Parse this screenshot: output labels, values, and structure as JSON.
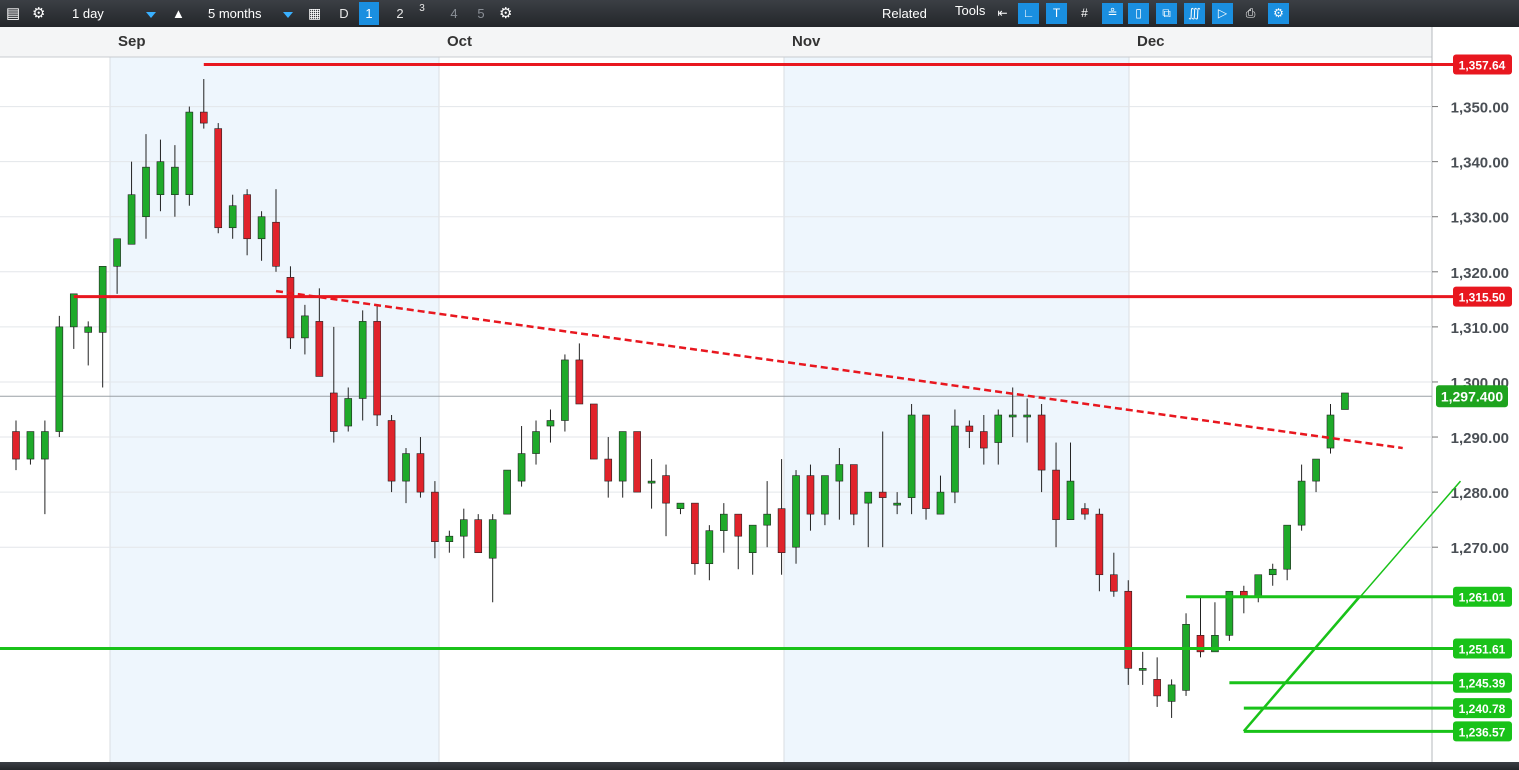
{
  "toolbar": {
    "interval": "1 day",
    "range": "5 months",
    "period_label": "D",
    "layout_numbers": [
      "1",
      "2",
      "3",
      "4",
      "5"
    ],
    "active_layout": "1",
    "related_label": "Related",
    "tools_label": "Tools"
  },
  "colors": {
    "up": "#1faa2a",
    "down": "#e0232b",
    "resistance": "#e8171f",
    "support": "#19c219",
    "last_price_tag": "#1ea31e",
    "shaded_month": "#eef6fd"
  },
  "chart_data": {
    "type": "candlestick",
    "x_labels": [
      "Sep",
      "Oct",
      "Nov",
      "Dec"
    ],
    "y_ticks": [
      "1,350.00",
      "1,340.00",
      "1,330.00",
      "1,320.00",
      "1,310.00",
      "1,300.00",
      "1,290.00",
      "1,280.00",
      "1,270.00"
    ],
    "ylim": [
      1231,
      1359
    ],
    "last_price": "1,297.400",
    "last_price_value": 1297.4,
    "horizontal_levels": [
      {
        "label": "1,357.64",
        "value": 1357.64,
        "kind": "resistance"
      },
      {
        "label": "1,315.50",
        "value": 1315.5,
        "kind": "resistance"
      },
      {
        "label": "1,261.01",
        "value": 1261.01,
        "kind": "support"
      },
      {
        "label": "1,251.61",
        "value": 1251.61,
        "kind": "support"
      },
      {
        "label": "1,245.39",
        "value": 1245.39,
        "kind": "support"
      },
      {
        "label": "1,240.78",
        "value": 1240.78,
        "kind": "support"
      },
      {
        "label": "1,236.57",
        "value": 1236.57,
        "kind": "support"
      }
    ],
    "trendlines": [
      {
        "style": "dashed",
        "kind": "resistance",
        "from": [
          18,
          1316.5
        ],
        "to": [
          96,
          1288.0
        ]
      },
      {
        "style": "solid",
        "kind": "support",
        "from": [
          85,
          1236.6
        ],
        "to": [
          100,
          1282.0
        ]
      }
    ],
    "candles": [
      [
        1291,
        1293,
        1284,
        1286
      ],
      [
        1286,
        1291,
        1285,
        1291
      ],
      [
        1286,
        1293,
        1276,
        1291
      ],
      [
        1291,
        1312,
        1290,
        1310
      ],
      [
        1310,
        1316,
        1306,
        1316
      ],
      [
        1309,
        1311,
        1303,
        1310
      ],
      [
        1309,
        1321,
        1299,
        1321
      ],
      [
        1321,
        1324,
        1316,
        1326
      ],
      [
        1325,
        1340,
        1325,
        1334
      ],
      [
        1330,
        1345,
        1326,
        1339
      ],
      [
        1334,
        1344,
        1331,
        1340
      ],
      [
        1334,
        1343,
        1330,
        1339
      ],
      [
        1334,
        1350,
        1332,
        1349
      ],
      [
        1349,
        1355,
        1346,
        1347
      ],
      [
        1346,
        1347,
        1327,
        1328
      ],
      [
        1328,
        1334,
        1326,
        1332
      ],
      [
        1334,
        1335,
        1323,
        1326
      ],
      [
        1326,
        1331,
        1322,
        1330
      ],
      [
        1329,
        1335,
        1320,
        1321
      ],
      [
        1319,
        1321,
        1306,
        1308
      ],
      [
        1308,
        1314,
        1305,
        1312
      ],
      [
        1311,
        1317,
        1301,
        1301
      ],
      [
        1298,
        1310,
        1289,
        1291
      ],
      [
        1292,
        1299,
        1291,
        1297
      ],
      [
        1297,
        1313,
        1293,
        1311
      ],
      [
        1311,
        1314,
        1292,
        1294
      ],
      [
        1293,
        1294,
        1280,
        1282
      ],
      [
        1282,
        1288,
        1278,
        1287
      ],
      [
        1287,
        1290,
        1279,
        1280
      ],
      [
        1280,
        1282,
        1268,
        1271
      ],
      [
        1271,
        1273,
        1269,
        1272
      ],
      [
        1272,
        1277,
        1268,
        1275
      ],
      [
        1275,
        1276,
        1269,
        1269
      ],
      [
        1268,
        1276,
        1260,
        1275
      ],
      [
        1276,
        1284,
        1276,
        1284
      ],
      [
        1282,
        1292,
        1281,
        1287
      ],
      [
        1287,
        1293,
        1285,
        1291
      ],
      [
        1292,
        1295,
        1289,
        1293
      ],
      [
        1293,
        1305,
        1291,
        1304
      ],
      [
        1304,
        1307,
        1296,
        1296
      ],
      [
        1296,
        1295,
        1286,
        1286
      ],
      [
        1286,
        1290,
        1279,
        1282
      ],
      [
        1282,
        1291,
        1279,
        1291
      ],
      [
        1291,
        1291,
        1280,
        1280
      ],
      [
        1282,
        1286,
        1277,
        1282
      ],
      [
        1283,
        1285,
        1272,
        1278
      ],
      [
        1277,
        1278,
        1276,
        1278
      ],
      [
        1278,
        1277,
        1265,
        1267
      ],
      [
        1267,
        1274,
        1264,
        1273
      ],
      [
        1273,
        1278,
        1269,
        1276
      ],
      [
        1276,
        1276,
        1266,
        1272
      ],
      [
        1269,
        1274,
        1265,
        1274
      ],
      [
        1274,
        1282,
        1270,
        1276
      ],
      [
        1277,
        1286,
        1265,
        1269
      ],
      [
        1270,
        1284,
        1267,
        1283
      ],
      [
        1283,
        1285,
        1273,
        1276
      ],
      [
        1276,
        1283,
        1274,
        1283
      ],
      [
        1282,
        1288,
        1275,
        1285
      ],
      [
        1285,
        1283,
        1274,
        1276
      ],
      [
        1278,
        1280,
        1270,
        1280
      ],
      [
        1280,
        1291,
        1270,
        1279
      ],
      [
        1278,
        1280,
        1276,
        1278
      ],
      [
        1279,
        1296,
        1276,
        1294
      ],
      [
        1294,
        1293,
        1275,
        1277
      ],
      [
        1276,
        1283,
        1276,
        1280
      ],
      [
        1280,
        1295,
        1278,
        1292
      ],
      [
        1292,
        1293,
        1288,
        1291
      ],
      [
        1291,
        1294,
        1285,
        1288
      ],
      [
        1289,
        1295,
        1285,
        1294
      ],
      [
        1294,
        1299,
        1290,
        1294
      ],
      [
        1294,
        1297,
        1289,
        1294
      ],
      [
        1294,
        1296,
        1280,
        1284
      ],
      [
        1284,
        1289,
        1270,
        1275
      ],
      [
        1275,
        1289,
        1275,
        1282
      ],
      [
        1277,
        1278,
        1275,
        1276
      ],
      [
        1276,
        1277,
        1262,
        1265
      ],
      [
        1265,
        1269,
        1261,
        1262
      ],
      [
        1262,
        1264,
        1245,
        1248
      ],
      [
        1248,
        1251,
        1245,
        1248
      ],
      [
        1246,
        1250,
        1241,
        1243
      ],
      [
        1242,
        1246,
        1239,
        1245
      ],
      [
        1244,
        1258,
        1243,
        1256
      ],
      [
        1254,
        1261,
        1250,
        1251
      ],
      [
        1251,
        1260,
        1251,
        1254
      ],
      [
        1254,
        1261,
        1253,
        1262
      ],
      [
        1262,
        1263,
        1258,
        1261
      ],
      [
        1261,
        1265,
        1260,
        1265
      ],
      [
        1265,
        1267,
        1263,
        1266
      ],
      [
        1266,
        1269,
        1264,
        1274
      ],
      [
        1274,
        1285,
        1273,
        1282
      ],
      [
        1282,
        1284,
        1280,
        1286
      ],
      [
        1288,
        1296,
        1287,
        1294
      ],
      [
        1295,
        1298,
        1296,
        1298
      ]
    ]
  }
}
